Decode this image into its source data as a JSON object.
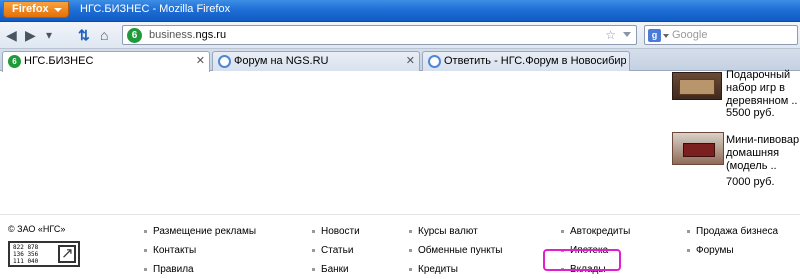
{
  "window": {
    "firefox_button": "Firefox",
    "title": "НГС.БИЗНЕС - Mozilla Firefox"
  },
  "navbar": {
    "url_domain_prefix": "business.",
    "url_domain_main": "ngs.ru",
    "site_icon_letter": "6",
    "search_placeholder": "Google"
  },
  "tabs": [
    {
      "label": "НГС.БИЗНЕС",
      "icon": "ngs-site-icon"
    },
    {
      "label": "Форум на NGS.RU",
      "icon": "forum-icon"
    },
    {
      "label": "Ответить - НГС.Форум в Новосибирске",
      "icon": "forum-icon"
    }
  ],
  "sidebar": {
    "products": [
      {
        "title_lines": [
          "Подарочный",
          "набор игр в",
          "деревянном .."
        ],
        "price": "5500 руб."
      },
      {
        "title_lines": [
          "Мини-пивовар",
          "домашняя",
          "(модель .."
        ],
        "price": "7000 руб."
      }
    ]
  },
  "footer": {
    "copyright": "© ЗАО «НГС»",
    "phone_digits": "822 878\n136 356\n111 040",
    "columns": [
      [
        "Размещение рекламы",
        "Контакты",
        "Правила"
      ],
      [
        "Новости",
        "Статьи",
        "Банки"
      ],
      [
        "Курсы валют",
        "Обменные пункты",
        "Кредиты"
      ],
      [
        "Автокредиты",
        "Ипотека",
        "Вклады"
      ],
      [
        "Продажа бизнеса",
        "Форумы"
      ]
    ]
  },
  "colors": {
    "titlebar": "#1f6fd6",
    "firefox_button": "#e56f06",
    "ngs_green": "#1f9a3a",
    "highlight": "#e020d0"
  }
}
